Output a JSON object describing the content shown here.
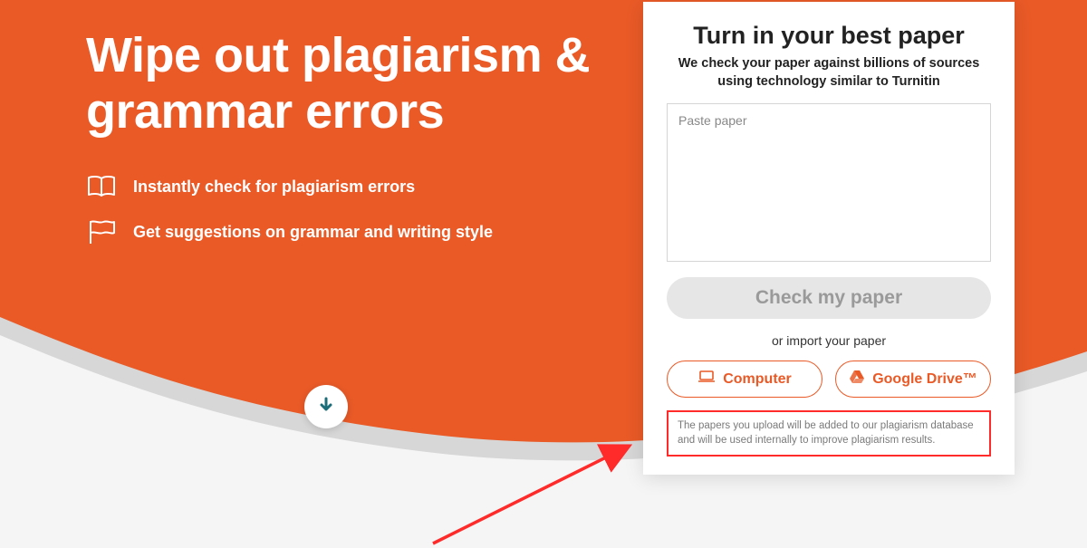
{
  "hero": {
    "headline": "Wipe out plagiarism & grammar errors",
    "features": [
      {
        "text": "Instantly check for plagiarism errors"
      },
      {
        "text": "Get suggestions on grammar and writing style"
      }
    ]
  },
  "card": {
    "title": "Turn in your best paper",
    "subtitle": "We check your paper against billions of sources using technology similar to Turnitin",
    "paste_placeholder": "Paste paper",
    "check_label": "Check my paper",
    "import_label": "or import your paper",
    "computer_label": "Computer",
    "gdrive_label": "Google Drive™",
    "disclaimer": "The papers you upload will be added to our plagiarism database and will be used internally to improve plagiarism results."
  },
  "colors": {
    "brand_orange": "#e95a27",
    "grey_curve": "#d7d7d7",
    "disabled_grey": "#e6e6e6",
    "arrow_red": "#ff2a2a",
    "scroll_arrow": "#1c6d7a"
  }
}
